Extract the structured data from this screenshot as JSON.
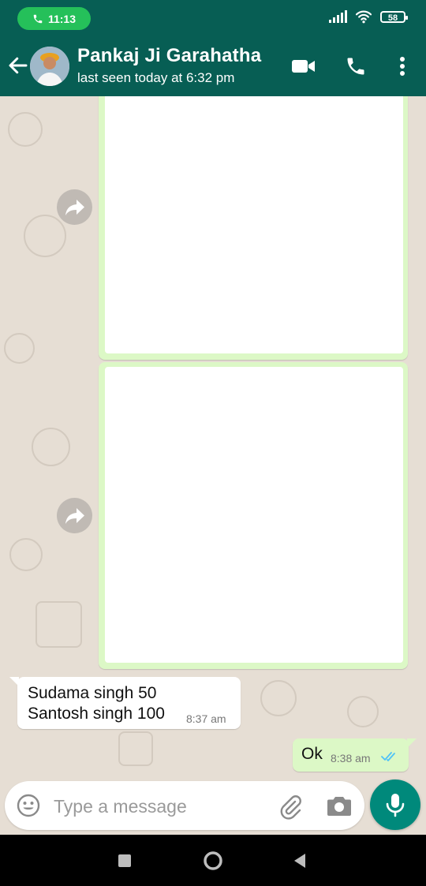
{
  "status_bar": {
    "time": "11:13",
    "battery": "58",
    "icons": [
      "phone-icon",
      "signal-icon",
      "wifi-icon",
      "battery-icon"
    ]
  },
  "header": {
    "contact_name": "Pankaj Ji Garahatha",
    "last_seen": "last seen today at 6:32 pm",
    "icons": [
      "back-arrow-icon",
      "video-call-icon",
      "voice-call-icon",
      "more-options-icon"
    ]
  },
  "messages": [
    {
      "type": "image",
      "direction": "outgoing",
      "forward_icon": "forward-icon"
    },
    {
      "type": "image",
      "direction": "outgoing",
      "forward_icon": "forward-icon"
    },
    {
      "type": "text",
      "direction": "incoming",
      "lines": [
        "Sudama singh 50",
        "Santosh singh 100"
      ],
      "time": "8:37 am"
    },
    {
      "type": "text",
      "direction": "outgoing",
      "text": "Ok",
      "time": "8:38 am",
      "status": "read"
    }
  ],
  "input": {
    "placeholder": "Type a message",
    "icons": [
      "emoji-icon",
      "attach-icon",
      "camera-icon",
      "mic-icon"
    ]
  },
  "colors": {
    "header": "#075e54",
    "outgoing_bubble": "#dcf8c6",
    "incoming_bubble": "#ffffff",
    "chat_background": "#e6ded4",
    "mic_button": "#00897b",
    "read_ticks": "#4fc3f7",
    "call_pill": "#25c05a"
  },
  "nav_bar": {
    "icons": [
      "recents-icon",
      "home-icon",
      "back-icon"
    ]
  }
}
